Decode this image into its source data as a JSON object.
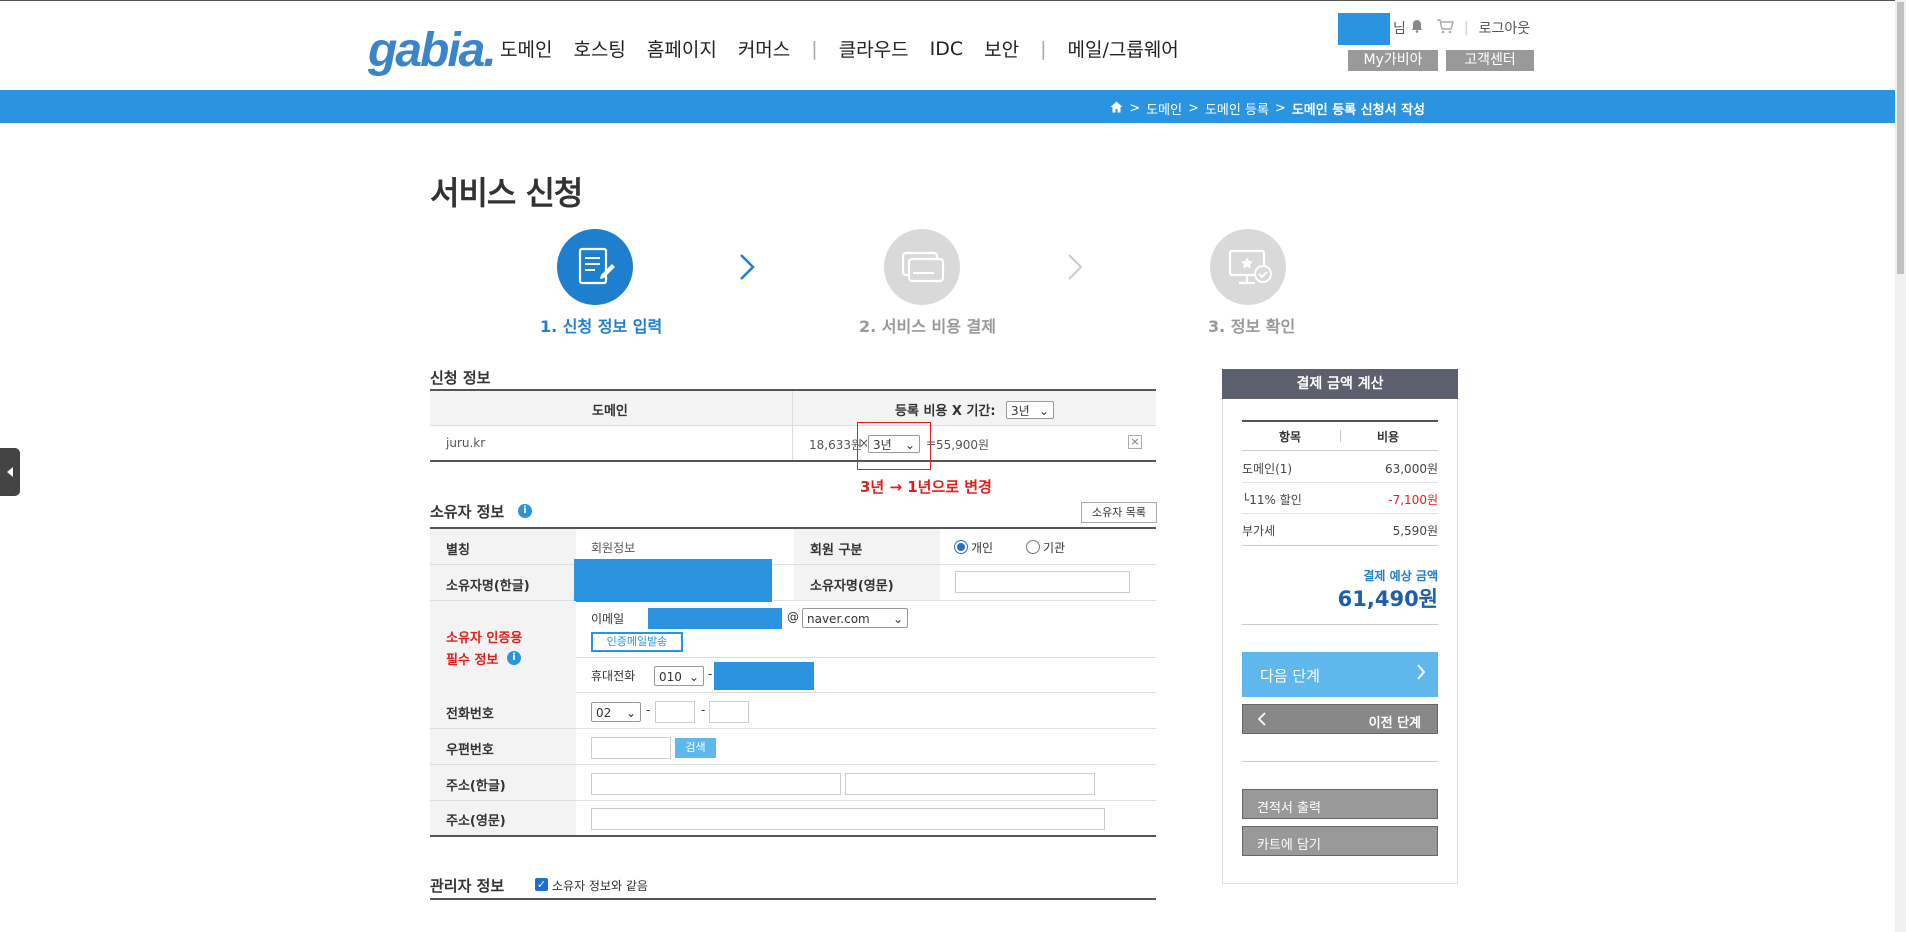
{
  "header": {
    "logo_text": "gabia.",
    "nav": [
      "도메인",
      "호스팅",
      "홈페이지",
      "커머스",
      "클라우드",
      "IDC",
      "보안",
      "메일/그룹웨어"
    ],
    "nav_separator": "|",
    "user_suffix": "님",
    "logout": "로그아웃",
    "my_gabia": "My가비아",
    "customer_center": "고객센터"
  },
  "breadcrumb": {
    "items": [
      "도메인",
      "도메인 등록"
    ],
    "current": "도메인 등록 신청서 작성",
    "separator": ">"
  },
  "page_title": "서비스 신청",
  "steps": [
    {
      "label": "1. 신청 정보 입력",
      "active": true
    },
    {
      "label": "2. 서비스 비용 결제",
      "active": false
    },
    {
      "label": "3. 정보 확인",
      "active": false
    }
  ],
  "apply_info": {
    "title": "신청 정보",
    "col_domain": "도메인",
    "col_cost": "등록 비용 X 기간:",
    "period_header_value": "3년",
    "domain": "juru.kr",
    "unit_price": "18,633원",
    "times": "×",
    "period_value": "3년",
    "equals": "=",
    "total": "55,900원",
    "remove": "×",
    "annotation": "3년 → 1년으로 변경"
  },
  "owner_info": {
    "title": "소유자 정보",
    "owner_list_button": "소유자 목록",
    "alias_label": "별칭",
    "alias_value": "회원정보",
    "member_type_label": "회원 구분",
    "member_type_personal": "개인",
    "member_type_org": "기관",
    "name_kr_label": "소유자명(한글)",
    "name_en_label": "소유자명(영문)",
    "auth_label_line1": "소유자 인증용",
    "auth_label_line2": "필수 정보",
    "email_label": "이메일",
    "email_at": "@",
    "email_domain": "naver.com",
    "send_auth_mail": "인증메일발송",
    "mobile_label": "휴대전화",
    "mobile_prefix": "010",
    "dash": "-",
    "phone_label": "전화번호",
    "phone_prefix": "02",
    "zip_label": "우편번호",
    "zip_search": "검색",
    "addr_kr_label": "주소(한글)",
    "addr_en_label": "주소(영문)"
  },
  "admin_info": {
    "title": "관리자 정보",
    "same_as_owner": "소유자 정보와 같음"
  },
  "payment": {
    "title": "결제 금액 계산",
    "col_item": "항목",
    "col_cost": "비용",
    "rows": [
      {
        "label": "도메인(1)",
        "value": "63,000원",
        "discount": false
      },
      {
        "label": "└11% 할인",
        "value": "-7,100원",
        "discount": true
      },
      {
        "label": "부가세",
        "value": "5,590원",
        "discount": false
      }
    ],
    "expected_label": "결제 예상 금액",
    "expected_total": "61,490원",
    "next_button": "다음 단계",
    "prev_button": "이전 단계",
    "quote_button": "견적서 출력",
    "cart_button": "카트에 담기"
  },
  "colors": {
    "brand_blue": "#2b94e1",
    "step_active": "#1e7fcf",
    "step_inactive": "#d9d9d9",
    "annotation_red": "#e0201c",
    "panel_header": "#5b5f6e",
    "next_button": "#5fb8ec"
  }
}
